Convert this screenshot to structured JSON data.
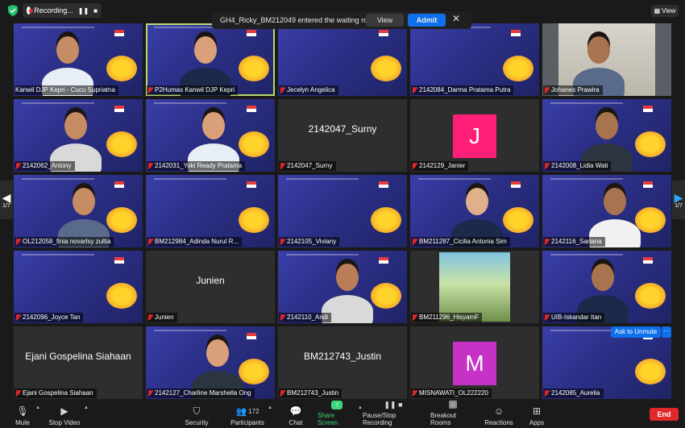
{
  "recording": {
    "label": "Recording..."
  },
  "notification": {
    "text": "GH4_Ricky_BM212049 entered the waiting room",
    "view_label": "View",
    "admit_label": "Admit",
    "close_glyph": "✕"
  },
  "view_button": {
    "label": "View"
  },
  "nav": {
    "left_page": "1/7",
    "right_page": "1/7"
  },
  "unmute": {
    "label": "Ask to Unmute",
    "more": "···"
  },
  "tiles": [
    {
      "name": "Kanwil DJP Kepri - Cucu Supriatna",
      "muted": false,
      "kind": "banner"
    },
    {
      "name": "P2Humas Kanwil DJP Kepri",
      "muted": true,
      "kind": "banner",
      "highlight": true
    },
    {
      "name": "Jecelyn Angelica",
      "muted": true,
      "kind": "banner"
    },
    {
      "name": "2142084_Darma Pratama Putra",
      "muted": true,
      "kind": "banner"
    },
    {
      "name": "Johanes Prawira",
      "muted": true,
      "kind": "cam"
    },
    {
      "name": "2142062_Antony",
      "muted": true,
      "kind": "banner"
    },
    {
      "name": "2142031_Yoki Ready Pratama",
      "muted": true,
      "kind": "banner"
    },
    {
      "name": "2142047_Surny",
      "muted": true,
      "kind": "gray",
      "display": "2142047_Surny"
    },
    {
      "name": "2142129_Janier",
      "muted": true,
      "kind": "letter",
      "letter": "J"
    },
    {
      "name": "2142008_Lidia Wati",
      "muted": true,
      "kind": "banner"
    },
    {
      "name": "OL212058_finia novarlsy zultia",
      "muted": true,
      "kind": "banner"
    },
    {
      "name": "BM212984_Adinda Nurul R...",
      "muted": true,
      "kind": "banner"
    },
    {
      "name": "2142105_Viviany",
      "muted": true,
      "kind": "banner"
    },
    {
      "name": "BM211287_Cicilia Antonia Sim",
      "muted": true,
      "kind": "banner"
    },
    {
      "name": "2142116_Sariana",
      "muted": true,
      "kind": "banner"
    },
    {
      "name": "2142096_Joyce Tan",
      "muted": true,
      "kind": "banner"
    },
    {
      "name": "Junien",
      "muted": true,
      "kind": "gray",
      "display": "Junien"
    },
    {
      "name": "2142110_Andi",
      "muted": true,
      "kind": "banner"
    },
    {
      "name": "BM211296_HisyamF",
      "muted": true,
      "kind": "poster"
    },
    {
      "name": "UIB-Iskandar Itan",
      "muted": true,
      "kind": "banner"
    },
    {
      "name": "Ejani Gospelina Siahaan",
      "muted": true,
      "kind": "gray",
      "display": "Ejani Gospelina Siahaan"
    },
    {
      "name": "2142127_Charline Marshella Ong",
      "muted": true,
      "kind": "banner"
    },
    {
      "name": "BM212743_Justin",
      "muted": true,
      "kind": "gray",
      "display": "BM212743_Justin"
    },
    {
      "name": "MISNAWATI_OL222220",
      "muted": true,
      "kind": "letter",
      "letter": "M"
    },
    {
      "name": "2142085_Aurelia",
      "muted": true,
      "kind": "banner"
    }
  ],
  "toolbar": {
    "mute": "Mute",
    "stop_video": "Stop Video",
    "security": "Security",
    "participants": "Participants",
    "participants_count": "172",
    "chat": "Chat",
    "share_screen": "Share Screen",
    "record": "Pause/Stop Recording",
    "breakout": "Breakout Rooms",
    "reactions": "Reactions",
    "apps": "Apps",
    "end": "End"
  },
  "colors": {
    "accent": "#0e71eb",
    "end": "#e02828",
    "share": "#3dd77e",
    "letter_j": "#ff1f78",
    "letter_m": "#c632c6",
    "highlight": "#b7d86f"
  }
}
